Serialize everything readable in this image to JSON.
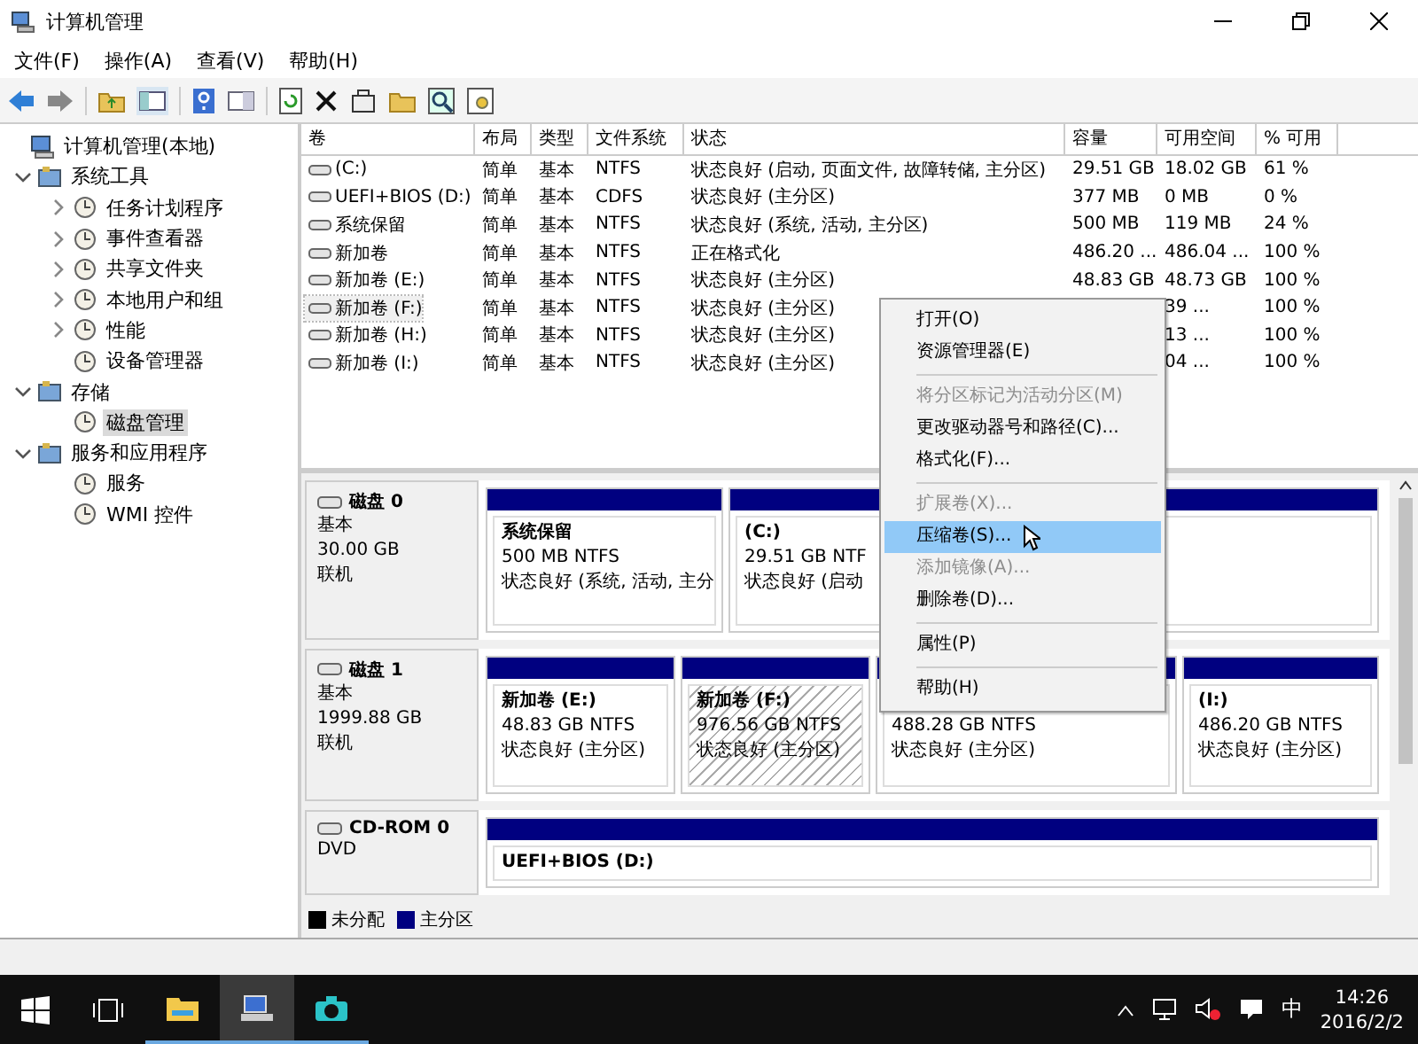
{
  "window": {
    "title": "计算机管理"
  },
  "menu_bar": [
    "文件(F)",
    "操作(A)",
    "查看(V)",
    "帮助(H)"
  ],
  "tree": [
    {
      "label": "计算机管理(本地)",
      "selected": false,
      "children": [
        {
          "label": "系统工具",
          "expanded": true,
          "selected": false,
          "children": [
            {
              "label": "任务计划程序",
              "expanded": false,
              "selected": false
            },
            {
              "label": "事件查看器",
              "expanded": false,
              "selected": false
            },
            {
              "label": "共享文件夹",
              "expanded": false,
              "selected": false
            },
            {
              "label": "本地用户和组",
              "expanded": false,
              "selected": false
            },
            {
              "label": "性能",
              "expanded": false,
              "selected": false
            },
            {
              "label": "设备管理器",
              "selected": false
            }
          ]
        },
        {
          "label": "存储",
          "expanded": true,
          "selected": false,
          "children": [
            {
              "label": "磁盘管理",
              "selected": true
            }
          ]
        },
        {
          "label": "服务和应用程序",
          "expanded": true,
          "selected": false,
          "children": [
            {
              "label": "服务",
              "selected": false
            },
            {
              "label": "WMI 控件",
              "selected": false
            }
          ]
        }
      ]
    }
  ],
  "table": {
    "columns": [
      "卷",
      "布局",
      "类型",
      "文件系统",
      "状态",
      "容量",
      "可用空间",
      "% 可用"
    ],
    "rows": [
      {
        "cells": [
          "(C:)",
          "简单",
          "基本",
          "NTFS",
          "状态良好 (启动, 页面文件, 故障转储, 主分区)",
          "29.51 GB",
          "18.02 GB",
          "61 %"
        ],
        "selected": false
      },
      {
        "cells": [
          "UEFI+BIOS (D:)",
          "简单",
          "基本",
          "CDFS",
          "状态良好 (主分区)",
          "377 MB",
          "0 MB",
          "0 %"
        ],
        "selected": false
      },
      {
        "cells": [
          "系统保留",
          "简单",
          "基本",
          "NTFS",
          "状态良好 (系统, 活动, 主分区)",
          "500 MB",
          "119 MB",
          "24 %"
        ],
        "selected": false
      },
      {
        "cells": [
          "新加卷",
          "简单",
          "基本",
          "NTFS",
          "正在格式化",
          "486.20 ...",
          "486.04 ...",
          "100 %"
        ],
        "selected": false
      },
      {
        "cells": [
          "新加卷 (E:)",
          "简单",
          "基本",
          "NTFS",
          "状态良好 (主分区)",
          "48.83 GB",
          "48.73 GB",
          "100 %"
        ],
        "selected": false
      },
      {
        "cells": [
          "新加卷 (F:)",
          "简单",
          "基本",
          "NTFS",
          "状态良好 (主分区)",
          "",
          "39 ...",
          "100 %"
        ],
        "selected": true
      },
      {
        "cells": [
          "新加卷 (H:)",
          "简单",
          "基本",
          "NTFS",
          "状态良好 (主分区)",
          "",
          "13 ...",
          "100 %"
        ],
        "selected": false
      },
      {
        "cells": [
          "新加卷 (I:)",
          "简单",
          "基本",
          "NTFS",
          "状态良好 (主分区)",
          "",
          "04 ...",
          "100 %"
        ],
        "selected": false
      }
    ]
  },
  "disks": [
    {
      "name": "磁盘 0",
      "details": [
        "基本",
        "30.00 GB",
        "联机"
      ],
      "partitions": [
        {
          "title": "系统保留",
          "lines": [
            "500 MB NTFS",
            "状态良好 (系统, 活动, 主分"
          ],
          "selected": false
        },
        {
          "title": "(C:)",
          "lines": [
            "29.51 GB NTF",
            "状态良好 (启动"
          ],
          "selected": false
        }
      ]
    },
    {
      "name": "磁盘 1",
      "details": [
        "基本",
        "1999.88 GB",
        "联机"
      ],
      "partitions": [
        {
          "title": "新加卷  (E:)",
          "lines": [
            "48.83 GB NTFS",
            "状态良好 (主分区)"
          ],
          "selected": false
        },
        {
          "title": "新加卷  (F:)",
          "lines": [
            "976.56 GB NTFS",
            "状态良好 (主分区)"
          ],
          "selected": true
        },
        {
          "lines": [
            "488.28 GB NTFS",
            "状态良好 (主分区)"
          ],
          "selected": false
        },
        {
          "title": "(I:)",
          "lines": [
            "486.20 GB NTFS",
            "状态良好 (主分区)"
          ],
          "selected": false
        }
      ]
    },
    {
      "name": "CD-ROM 0",
      "details": [
        "DVD"
      ],
      "partitions": [
        {
          "title": "UEFI+BIOS  (D:)",
          "selected": false
        }
      ]
    }
  ],
  "legend": [
    {
      "label": "未分配",
      "color": "#000000"
    },
    {
      "label": "主分区",
      "color": "#000080"
    }
  ],
  "context_menu": [
    {
      "kind": "item",
      "label": "打开(O)",
      "disabled": false,
      "selected": false
    },
    {
      "kind": "item",
      "label": "资源管理器(E)",
      "disabled": false,
      "selected": false
    },
    {
      "kind": "separator"
    },
    {
      "kind": "item",
      "label": "将分区标记为活动分区(M)",
      "disabled": true,
      "selected": false
    },
    {
      "kind": "item",
      "label": "更改驱动器号和路径(C)...",
      "disabled": false,
      "selected": false
    },
    {
      "kind": "item",
      "label": "格式化(F)...",
      "disabled": false,
      "selected": false
    },
    {
      "kind": "separator"
    },
    {
      "kind": "item",
      "label": "扩展卷(X)...",
      "disabled": true,
      "selected": false
    },
    {
      "kind": "item",
      "label": "压缩卷(S)...",
      "disabled": false,
      "selected": true
    },
    {
      "kind": "item",
      "label": "添加镜像(A)...",
      "disabled": true,
      "selected": false
    },
    {
      "kind": "item",
      "label": "删除卷(D)...",
      "disabled": false,
      "selected": false
    },
    {
      "kind": "separator"
    },
    {
      "kind": "item",
      "label": "属性(P)",
      "disabled": false,
      "selected": false
    },
    {
      "kind": "separator"
    },
    {
      "kind": "item",
      "label": "帮助(H)",
      "disabled": false,
      "selected": false
    }
  ],
  "taskbar": {
    "apps": [
      {
        "selected": false
      },
      {
        "selected": true
      },
      {
        "selected": false
      }
    ],
    "ime": "中",
    "time": "14:26",
    "date": "2016/2/2"
  }
}
